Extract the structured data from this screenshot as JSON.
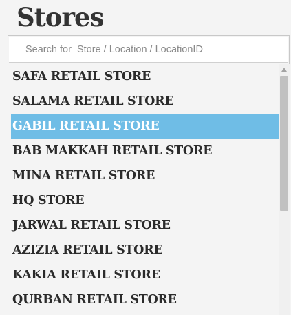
{
  "header": {
    "title": "Stores"
  },
  "search": {
    "placeholder": "Search for  Store / Location / LocationID",
    "value": ""
  },
  "stores": {
    "items": [
      {
        "label": "SAFA RETAIL STORE",
        "selected": false
      },
      {
        "label": "SALAMA RETAIL STORE",
        "selected": false
      },
      {
        "label": "GABIL RETAIL STORE",
        "selected": true
      },
      {
        "label": "BAB MAKKAH RETAIL STORE",
        "selected": false
      },
      {
        "label": "MINA RETAIL STORE",
        "selected": false
      },
      {
        "label": "HQ STORE",
        "selected": false
      },
      {
        "label": "JARWAL RETAIL STORE",
        "selected": false
      },
      {
        "label": "AZIZIA RETAIL STORE",
        "selected": false
      },
      {
        "label": "KAKIA RETAIL STORE",
        "selected": false
      },
      {
        "label": "QURBAN RETAIL STORE",
        "selected": false
      }
    ]
  },
  "colors": {
    "selected_bg": "#6fbde6",
    "selected_text": "#ffffff",
    "item_text": "#2b2b2b",
    "title_text": "#333333"
  },
  "icons": {
    "scroll_up": "chevron-up-icon"
  }
}
